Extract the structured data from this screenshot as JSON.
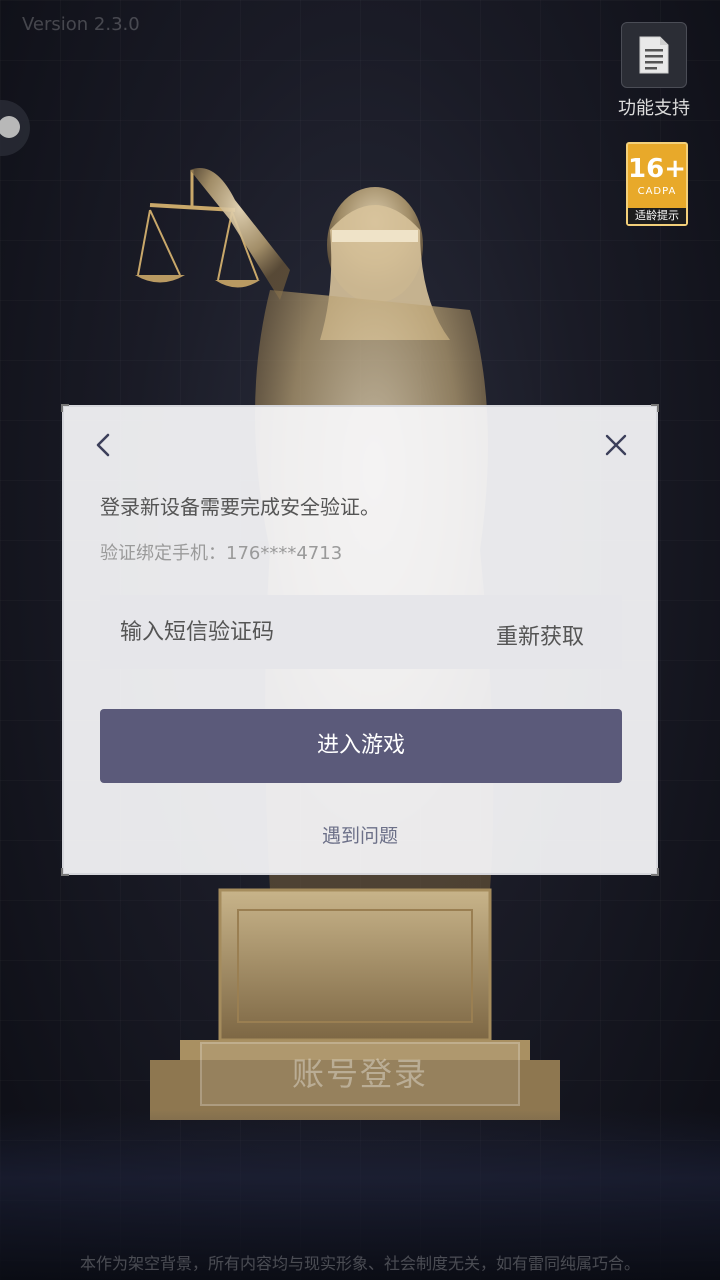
{
  "app": {
    "version": "Version 2.3.0"
  },
  "top_right": {
    "support_label": "功能支持",
    "age_rating": "16+",
    "age_org": "CADPA",
    "age_tip": "适龄提示"
  },
  "background": {
    "account_login_label": "账号登录",
    "disclaimer": "本作为架空背景，所有内容均与现实形象、社会制度无关，如有雷同纯属巧合。"
  },
  "dialog": {
    "message": "登录新设备需要完成安全验证。",
    "phone_line": "验证绑定手机：176****4713",
    "code_input": {
      "placeholder": "输入短信验证码",
      "value": ""
    },
    "resend_label": "重新获取",
    "enter_label": "进入游戏",
    "problem_label": "遇到问题"
  },
  "colors": {
    "primary_button": "#5b5a7a",
    "age_badge": "#e8a92a"
  },
  "icons": {
    "support": "document-icon",
    "back": "chevron-left-icon",
    "close": "close-icon",
    "float": "floating-ball-icon"
  }
}
